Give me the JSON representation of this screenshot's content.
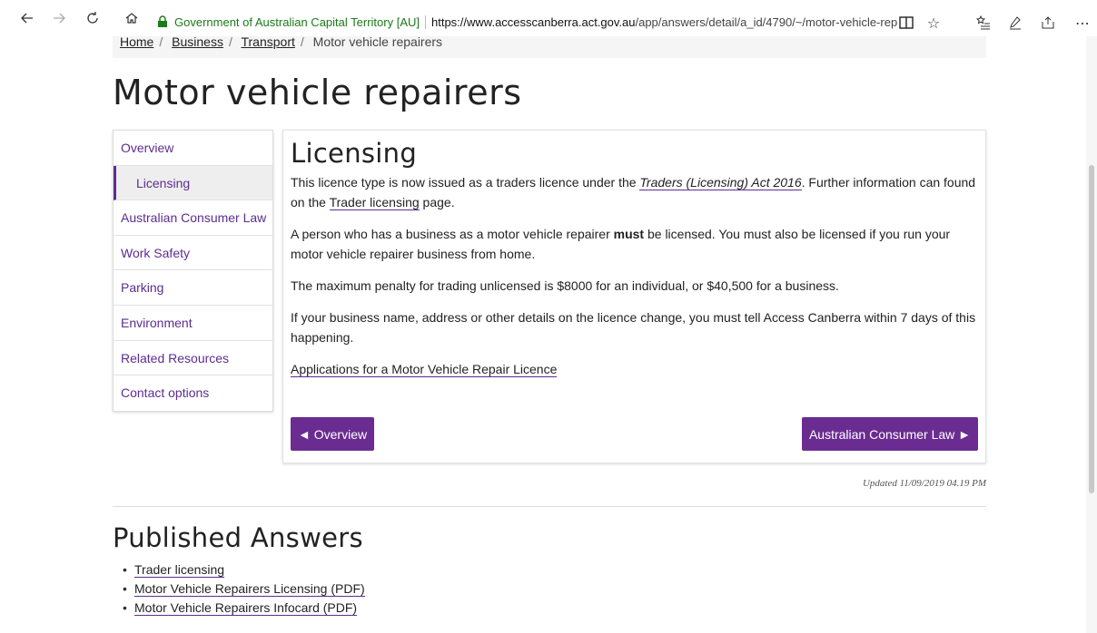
{
  "browser": {
    "site_identity": "Government of Australian Capital Territory [AU]",
    "url_domain": "https://www.accesscanberra.act.gov.au",
    "url_path": "/app/answers/detail/a_id/4790/~/motor-vehicle-rep",
    "icons": [
      "back-icon",
      "forward-icon",
      "refresh-icon",
      "home-icon",
      "lock-icon",
      "reading-view-icon",
      "favorite-star-icon",
      "favorites-hub-icon",
      "notes-pen-icon",
      "share-icon",
      "more-icon"
    ]
  },
  "breadcrumb": {
    "items": [
      "Home",
      "Business",
      "Transport"
    ],
    "current": "Motor vehicle repairers"
  },
  "page_title": "Motor vehicle repairers",
  "sidenav": {
    "items": [
      "Overview",
      "Licensing",
      "Australian Consumer Law",
      "Work Safety",
      "Parking",
      "Environment",
      "Related Resources",
      "Contact options"
    ],
    "active": "Licensing"
  },
  "content": {
    "heading": "Licensing",
    "p1_before": "This licence type is now issued as a traders licence under the ",
    "p1_link": "Traders (Licensing) Act 2016",
    "p1_mid": ". Further information can found on the ",
    "p1_link2": "Trader licensing",
    "p1_after": " page.",
    "p2_before": "A person who has a business as a motor vehicle repairer ",
    "p2_bold": "must",
    "p2_after": " be licensed.  You must also be licensed if you run your motor vehicle repairer business from home.",
    "p3": "The maximum penalty for trading unlicensed is $8000 for an individual, or $40,500 for a business.",
    "p4": "If your business name, address or other details on the licence change, you must tell Access Canberra within 7 days of this happening.",
    "link_apply": "Applications for a Motor Vehicle Repair Licence",
    "btn_prev": "◄ Overview",
    "btn_next": "Australian Consumer Law ►"
  },
  "updated": "Updated 11/09/2019 04.19 PM",
  "published": {
    "heading": "Published Answers",
    "items": [
      "Trader licensing",
      "Motor Vehicle Repairers Licensing (PDF)",
      "Motor Vehicle Repairers Infocard (PDF)"
    ]
  },
  "colors": {
    "accent": "#6a2c91",
    "nav_text": "#5c2d91",
    "secure_green": "#1b7a1b"
  }
}
